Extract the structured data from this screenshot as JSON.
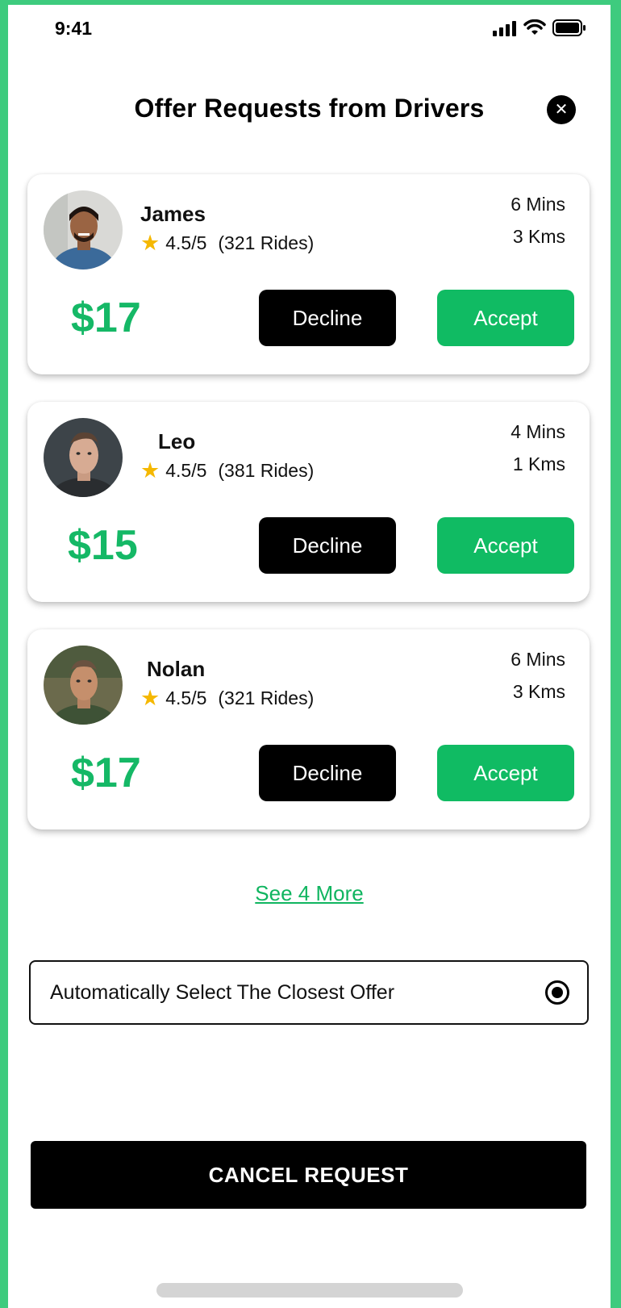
{
  "status_bar": {
    "time": "9:41"
  },
  "header": {
    "title": "Offer Requests from Drivers",
    "close_icon": "close-icon"
  },
  "offers": [
    {
      "name": "James",
      "rating": "4.5/5",
      "rides": "(321 Rides)",
      "eta": "6 Mins",
      "distance": "3 Kms",
      "price": "$17",
      "decline_label": "Decline",
      "accept_label": "Accept"
    },
    {
      "name": "Leo",
      "rating": "4.5/5",
      "rides": "(381 Rides)",
      "eta": "4 Mins",
      "distance": "1 Kms",
      "price": "$15",
      "decline_label": "Decline",
      "accept_label": "Accept"
    },
    {
      "name": "Nolan",
      "rating": "4.5/5",
      "rides": "(321 Rides)",
      "eta": "6 Mins",
      "distance": "3 Kms",
      "price": "$17",
      "decline_label": "Decline",
      "accept_label": "Accept"
    }
  ],
  "see_more": "See 4 More",
  "auto_select": {
    "label": "Automatically Select The Closest Offer",
    "selected": true
  },
  "cancel_button": "CANCEL REQUEST",
  "colors": {
    "accent_green": "#10bb63",
    "price_green": "#15b866",
    "star_yellow": "#f5b800",
    "frame_green": "#3ecb7e"
  }
}
